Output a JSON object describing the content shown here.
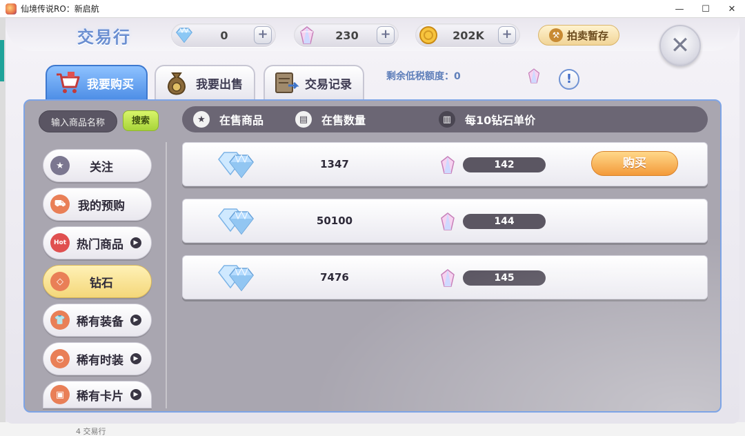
{
  "window": {
    "title": "仙境传说RO：新启航",
    "min_glyph": "—",
    "max_glyph": "☐",
    "close_glyph": "✕"
  },
  "bg_footer_text": "4 交易行",
  "header": {
    "title": "交易行",
    "resources": [
      {
        "icon": "diamond-icon",
        "value": "0"
      },
      {
        "icon": "crystal-icon",
        "value": "230"
      },
      {
        "icon": "coin-icon",
        "value": "202K"
      }
    ],
    "plus_label": "+",
    "auction_label": "拍卖暂存",
    "close_glyph": "✕"
  },
  "tabs": [
    {
      "label": "我要购买",
      "icon": "cart-icon"
    },
    {
      "label": "我要出售",
      "icon": "money-bag-icon"
    },
    {
      "label": "交易记录",
      "icon": "records-icon"
    }
  ],
  "tax": {
    "label": "剩余低税额度：0",
    "info_glyph": "!"
  },
  "search": {
    "placeholder": "输入商品名称",
    "button": "搜索"
  },
  "categories": [
    {
      "label": "关注",
      "icon": "star-icon",
      "arrow": false
    },
    {
      "label": "我的预购",
      "icon": "cart-icon",
      "arrow": false
    },
    {
      "label": "热门商品",
      "icon": "hot-icon",
      "arrow": true
    },
    {
      "label": "钻石",
      "icon": "diamond-icon",
      "arrow": false
    },
    {
      "label": "稀有装备",
      "icon": "shirt-icon",
      "arrow": true
    },
    {
      "label": "稀有时装",
      "icon": "hat-icon",
      "arrow": true
    },
    {
      "label": "稀有卡片",
      "icon": "card-icon",
      "arrow": true
    }
  ],
  "columns": [
    {
      "label": "在售商品",
      "icon": "star-icon"
    },
    {
      "label": "在售数量",
      "icon": "clipboard-icon"
    },
    {
      "label": "每10钻石单价",
      "icon": "chart-icon"
    }
  ],
  "listings": [
    {
      "quantity": "1347",
      "price": "142",
      "buy_label": "购买"
    },
    {
      "quantity": "50100",
      "price": "144"
    },
    {
      "quantity": "7476",
      "price": "145"
    }
  ],
  "colors": {
    "accent": "#4e8ee6",
    "buy": "#f39a3a",
    "selected_category": "#f4d77a",
    "panel": "#a9a6b0"
  }
}
